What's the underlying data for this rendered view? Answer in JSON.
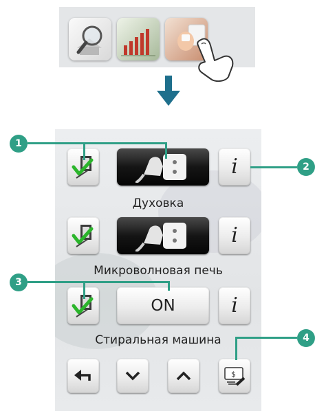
{
  "top_strip": {
    "thumbnails": [
      {
        "icon": "magnifier-house-icon"
      },
      {
        "icon": "chart-icon"
      },
      {
        "icon": "plug-hand-icon"
      }
    ]
  },
  "panel": {
    "devices": [
      {
        "name": "Духовка",
        "state": "plug-connected"
      },
      {
        "name": "Микроволновая печь",
        "state": "plug-connected"
      },
      {
        "name": "Стиральная машина",
        "state_label": "ON"
      }
    ],
    "info_label": "i",
    "nav": {
      "back": "back-icon",
      "down": "chevron-down-icon",
      "up": "chevron-up-icon",
      "costs": "costs-icon"
    }
  },
  "callouts": [
    "1",
    "2",
    "3",
    "4"
  ],
  "colors": {
    "accent": "#2f9f86",
    "callout_text": "#ffffff"
  }
}
